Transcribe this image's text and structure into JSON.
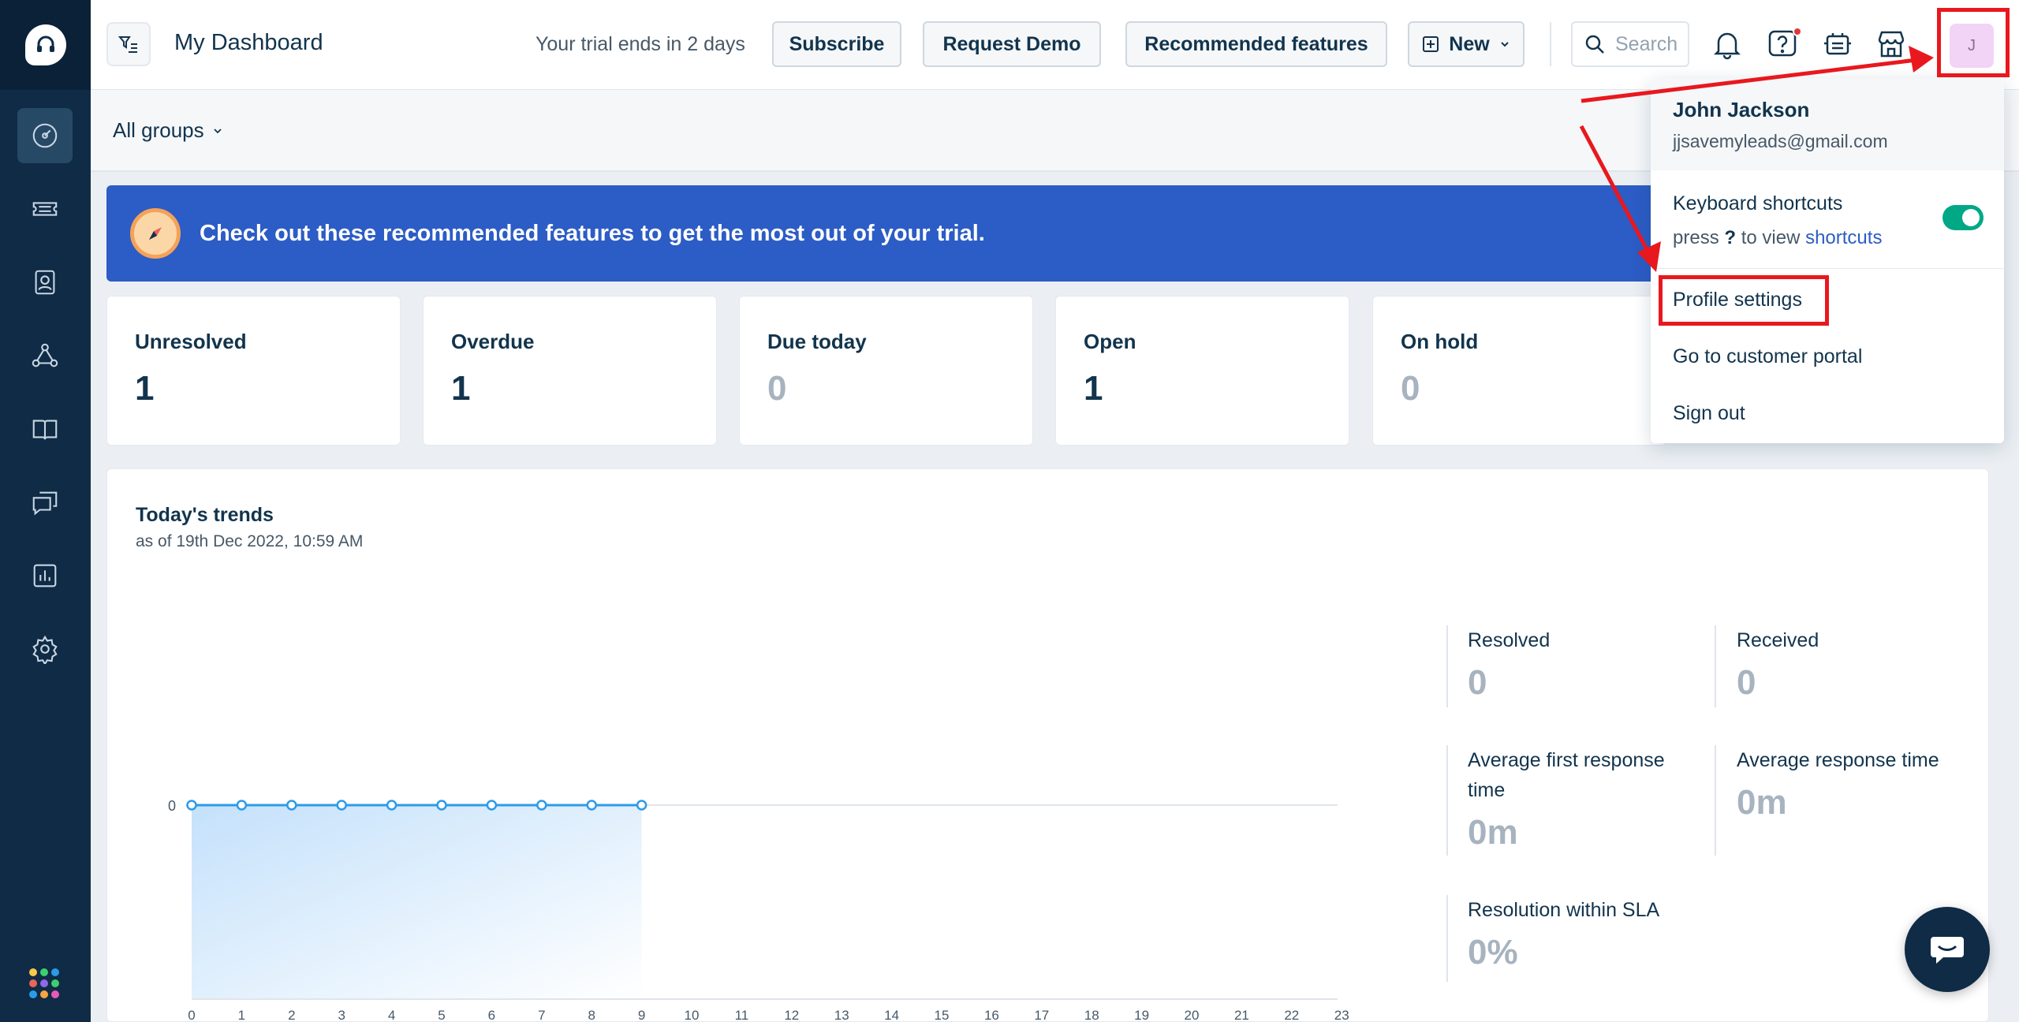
{
  "header": {
    "title": "My Dashboard",
    "trial_text": "Your trial ends in 2 days",
    "subscribe": "Subscribe",
    "request_demo": "Request Demo",
    "recommended": "Recommended features",
    "new": "New",
    "search_placeholder": "Search",
    "avatar_initial": "J"
  },
  "subheader": {
    "groups": "All groups"
  },
  "banner": {
    "text": "Check out these recommended features to get the most out of your trial."
  },
  "stats": [
    {
      "label": "Unresolved",
      "value": "1"
    },
    {
      "label": "Overdue",
      "value": "1"
    },
    {
      "label": "Due today",
      "value": "0"
    },
    {
      "label": "Open",
      "value": "1"
    },
    {
      "label": "On hold",
      "value": "0"
    }
  ],
  "trends": {
    "title": "Today's trends",
    "subtitle": "as of 19th Dec 2022, 10:59 AM",
    "metrics": [
      {
        "label": "Resolved",
        "value": "0"
      },
      {
        "label": "Received",
        "value": "0"
      },
      {
        "label": "Average first response time",
        "value": "0m"
      },
      {
        "label": "Average response time",
        "value": "0m"
      },
      {
        "label": "Resolution within SLA",
        "value": "0%"
      }
    ]
  },
  "chart_data": {
    "type": "area",
    "x": [
      "0",
      "1",
      "2",
      "3",
      "4",
      "5",
      "6",
      "7",
      "8",
      "9",
      "10",
      "11",
      "12",
      "13",
      "14",
      "15",
      "16",
      "17",
      "18",
      "19",
      "20",
      "21",
      "22",
      "23"
    ],
    "series": [
      {
        "values": [
          0,
          0,
          0,
          0,
          0,
          0,
          0,
          0,
          0,
          0
        ]
      }
    ],
    "yticks": [
      "0"
    ],
    "ylim": [
      0,
      0
    ],
    "line_color": "#2c9be7"
  },
  "dropdown": {
    "name": "John Jackson",
    "email": "jjsavemyleads@gmail.com",
    "keyboard_shortcuts": "Keyboard shortcuts",
    "press": "press",
    "press_key": "?",
    "to_view": "to view",
    "shortcuts_link": "shortcuts",
    "profile_settings": "Profile settings",
    "customer_portal": "Go to customer portal",
    "sign_out": "Sign out"
  },
  "colors": {
    "accent": "#2c5cc5",
    "sidebar": "#0f2b46",
    "annotation": "#e8181e",
    "toggle_on": "#00a886"
  }
}
